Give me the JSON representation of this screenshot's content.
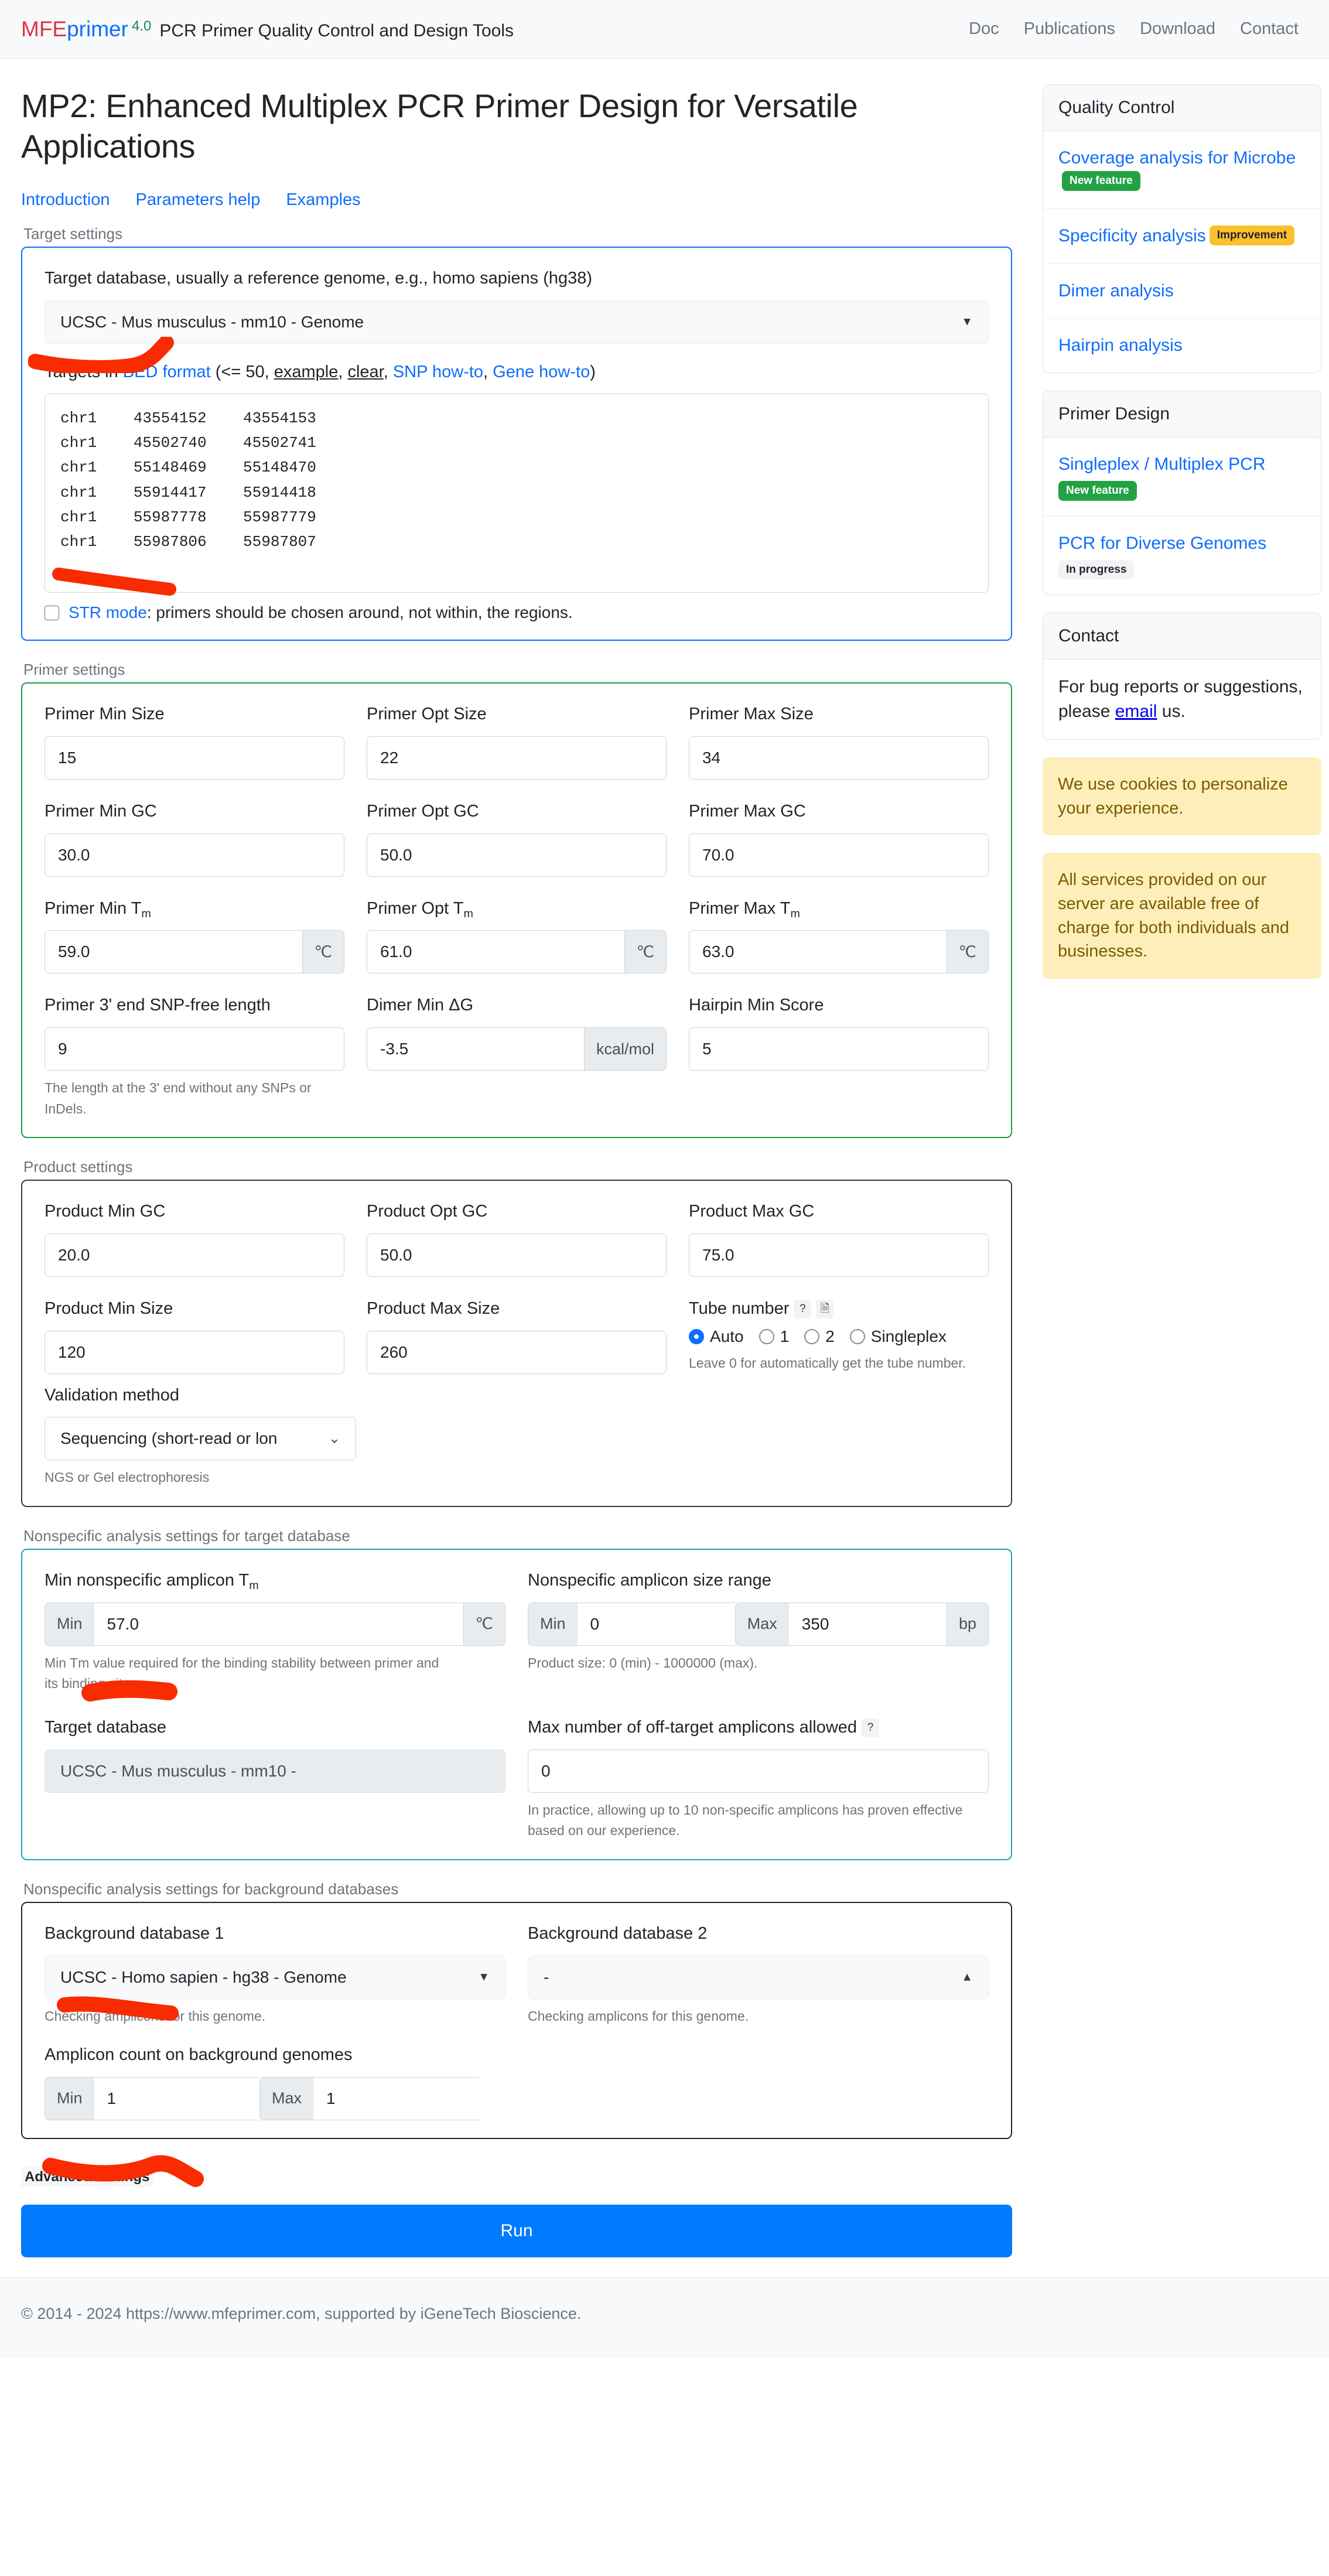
{
  "header": {
    "brand_mfe": "MFE",
    "brand_primer": "primer",
    "brand_version": "4.0",
    "brand_subtitle": "PCR Primer Quality Control and Design Tools",
    "nav": [
      {
        "label": "Doc"
      },
      {
        "label": "Publications"
      },
      {
        "label": "Download"
      },
      {
        "label": "Contact"
      }
    ]
  },
  "main": {
    "title": "MP2: Enhanced Multiplex PCR Primer Design for Versatile Applications",
    "anchors": [
      {
        "label": "Introduction"
      },
      {
        "label": "Parameters help"
      },
      {
        "label": "Examples"
      }
    ],
    "target_settings": {
      "legend": "Target settings",
      "db_label": "Target database, usually a reference genome, e.g., homo sapiens (hg38)",
      "db_value": "UCSC - Mus musculus - mm10 - Genome",
      "targets_label_prefix": "Targets in ",
      "targets_bed_link": "BED format",
      "targets_label_mid": " (<= 50, ",
      "targets_example": "example",
      "targets_comma1": ", ",
      "targets_clear": "clear",
      "targets_comma2": ", ",
      "targets_snp_howto": "SNP how-to",
      "targets_comma3": ", ",
      "targets_gene_howto": "Gene how-to",
      "targets_label_suffix": ")",
      "bed_text": "chr1    43554152    43554153\nchr1    45502740    45502741\nchr1    55148469    55148470\nchr1    55914417    55914418\nchr1    55987778    55987779\nchr1    55987806    55987807",
      "str_mode_link": "STR mode",
      "str_mode_text": ": primers should be chosen around, not within, the regions.",
      "str_mode_checked": false
    },
    "primer_settings": {
      "legend": "Primer settings",
      "fields": [
        {
          "label": "Primer Min Size",
          "value": "15"
        },
        {
          "label": "Primer Opt Size",
          "value": "22"
        },
        {
          "label": "Primer Max Size",
          "value": "34"
        },
        {
          "label": "Primer Min GC",
          "value": "30.0"
        },
        {
          "label": "Primer Opt GC",
          "value": "50.0"
        },
        {
          "label": "Primer Max GC",
          "value": "70.0"
        }
      ],
      "tm_label_min": "Primer Min T",
      "tm_label_opt": "Primer Opt T",
      "tm_label_max": "Primer Max T",
      "tm_sub": "m",
      "tm_min": "59.0",
      "tm_opt": "61.0",
      "tm_max": "63.0",
      "tm_unit": "℃",
      "snp_free_label": "Primer 3' end SNP-free length",
      "snp_free_value": "9",
      "snp_free_help": "The length at the 3' end without any SNPs or InDels.",
      "dimer_label": "Dimer Min ΔG",
      "dimer_value": "-3.5",
      "dimer_unit": "kcal/mol",
      "hairpin_label": "Hairpin Min Score",
      "hairpin_value": "5"
    },
    "product_settings": {
      "legend": "Product settings",
      "fields": [
        {
          "label": "Product Min GC",
          "value": "20.0"
        },
        {
          "label": "Product Opt GC",
          "value": "50.0"
        },
        {
          "label": "Product Max GC",
          "value": "75.0"
        },
        {
          "label": "Product Min Size",
          "value": "120"
        },
        {
          "label": "Product Max Size",
          "value": "260"
        }
      ],
      "tube_number_label": "Tube number",
      "tube_help_icon": "?",
      "tube_doc_icon": "὜E",
      "tube_options": [
        {
          "label": "Auto",
          "selected": true
        },
        {
          "label": "1",
          "selected": false
        },
        {
          "label": "2",
          "selected": false
        },
        {
          "label": "Singleplex",
          "selected": false
        }
      ],
      "tube_help": "Leave 0 for automatically get the tube number.",
      "validation_label": "Validation method",
      "validation_value": "Sequencing (short-read or lon",
      "validation_help": "NGS or Gel electrophoresis"
    },
    "nonspecific_target": {
      "legend": "Nonspecific analysis settings for target database",
      "min_tm_label": "Min nonspecific amplicon T",
      "min_tm_sub": "m",
      "min_tm_prefix": "Min",
      "min_tm_value": "57.0",
      "min_tm_unit": "℃",
      "min_tm_help": "Min Tm value required for the binding stability between primer and its binding sites.",
      "size_range_label": "Nonspecific amplicon size range",
      "size_min_prefix": "Min",
      "size_min_value": "0",
      "size_max_prefix": "Max",
      "size_max_value": "350",
      "size_unit": "bp",
      "size_help": "Product size: 0 (min) - 1000000 (max).",
      "target_db_label": "Target database",
      "target_db_value": "UCSC - Mus musculus - mm10 -",
      "offtarget_label": "Max number of off-target amplicons allowed",
      "offtarget_help_icon": "?",
      "offtarget_value": "0",
      "offtarget_help": "In practice, allowing up to 10 non-specific amplicons has proven effective based on our experience."
    },
    "nonspecific_background": {
      "legend": "Nonspecific analysis settings for background databases",
      "db1_label": "Background database 1",
      "db1_value": "UCSC - Homo sapien - hg38 - Genome",
      "db1_help": "Checking amplicons for this genome.",
      "db2_label": "Background database 2",
      "db2_value": "-",
      "db2_help": "Checking amplicons for this genome.",
      "amplicon_count_label": "Amplicon count on background genomes",
      "amplicon_min_prefix": "Min",
      "amplicon_min_value": "1",
      "amplicon_max_prefix": "Max",
      "amplicon_max_value": "1"
    },
    "advanced_settings_label": "Advanced settings",
    "run_label": "Run"
  },
  "sidebar": {
    "quality_control": {
      "title": "Quality Control",
      "items": [
        {
          "label": "Coverage analysis for Microbe",
          "badge": "New feature",
          "badge_kind": "new"
        },
        {
          "label": "Specificity analysis",
          "badge": "Improvement",
          "badge_kind": "imp"
        },
        {
          "label": "Dimer analysis",
          "badge": "",
          "badge_kind": ""
        },
        {
          "label": "Hairpin analysis",
          "badge": "",
          "badge_kind": ""
        }
      ]
    },
    "primer_design": {
      "title": "Primer Design",
      "items": [
        {
          "label": "Singleplex / Multiplex PCR",
          "badge": "New feature",
          "badge_kind": "new"
        },
        {
          "label": "PCR for Diverse Genomes",
          "badge": "In progress",
          "badge_kind": "prog"
        }
      ]
    },
    "contact": {
      "title": "Contact",
      "text_before": "For bug reports or suggestions, please ",
      "email_link": "email",
      "text_after": " us."
    },
    "notices": [
      {
        "text": "We use cookies to personalize your experience."
      },
      {
        "text": "All services provided on our server are available free of charge for both individuals and businesses."
      }
    ]
  },
  "footer": {
    "text": "© 2014 - 2024 https://www.mfeprimer.com, supported by iGeneTech Bioscience."
  },
  "colors": {
    "accent_blue": "#0d6efd",
    "run_blue": "#007bff",
    "green": "#1a9c45",
    "teal": "#17a2b8",
    "badge_new": "#23a244",
    "badge_improvement": "#fbc02d",
    "notice_bg": "#fdeeba",
    "annotation_red": "#f92b00"
  }
}
